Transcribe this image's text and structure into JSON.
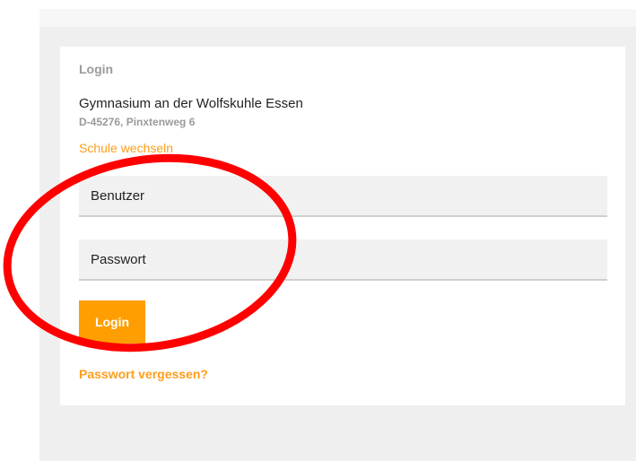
{
  "login": {
    "title": "Login",
    "school_name": "Gymnasium an der Wolfskuhle Essen",
    "school_address": "D-45276, Pinxtenweg 6",
    "switch_school_label": "Schule wechseln",
    "username_placeholder": "Benutzer",
    "password_placeholder": "Passwort",
    "submit_label": "Login",
    "forgot_password_label": "Passwort vergessen?"
  },
  "colors": {
    "accent": "#ff9e00",
    "link": "#ff9e1b",
    "annotation": "#ff0000",
    "page_background": "#efefef",
    "card_background": "#ffffff",
    "field_background": "#f1f1f1"
  }
}
